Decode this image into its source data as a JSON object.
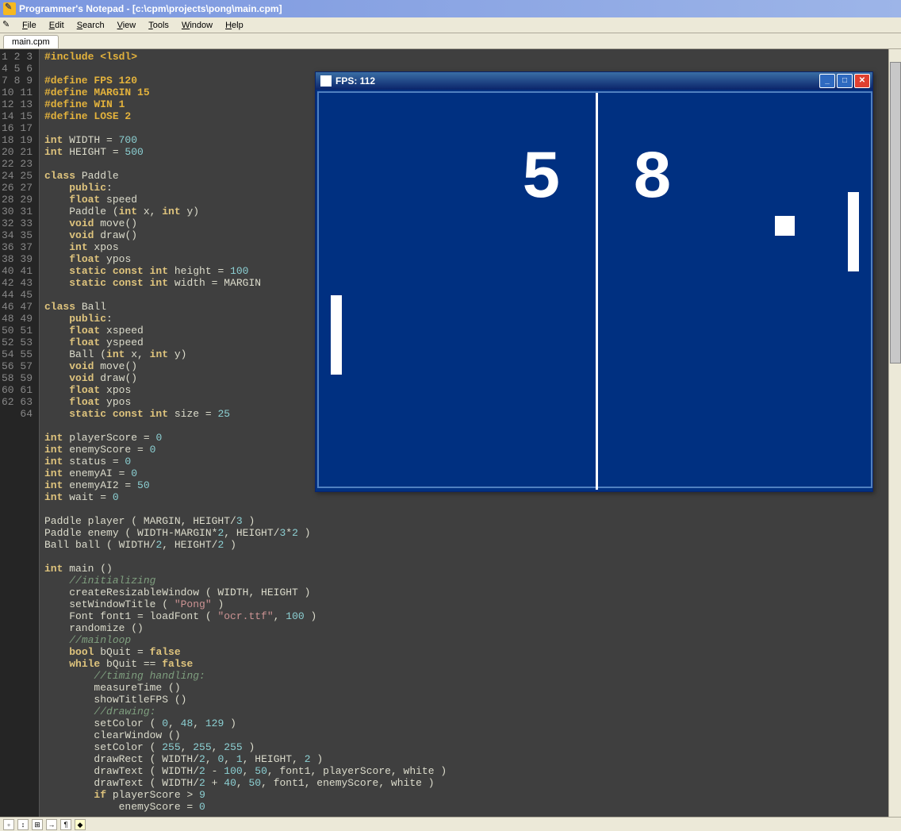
{
  "window_title": "Programmer's Notepad - [c:\\cpm\\projects\\pong\\main.cpm]",
  "menus": [
    "File",
    "Edit",
    "Search",
    "View",
    "Tools",
    "Window",
    "Help"
  ],
  "tab": "main.cpm",
  "line_count": 64,
  "code_lines": [
    {
      "n": 1,
      "html": "<span class='pp'>#include &lt;lsdl&gt;</span>"
    },
    {
      "n": 2,
      "html": ""
    },
    {
      "n": 3,
      "html": "<span class='pp'>#define FPS 120</span>"
    },
    {
      "n": 4,
      "html": "<span class='pp'>#define MARGIN 15</span>"
    },
    {
      "n": 5,
      "html": "<span class='pp'>#define WIN 1</span>"
    },
    {
      "n": 6,
      "html": "<span class='pp'>#define LOSE 2</span>"
    },
    {
      "n": 7,
      "html": ""
    },
    {
      "n": 8,
      "html": "<span class='kw'>int</span> WIDTH = <span class='num'>700</span>"
    },
    {
      "n": 9,
      "html": "<span class='kw'>int</span> HEIGHT = <span class='num'>500</span>"
    },
    {
      "n": 10,
      "html": ""
    },
    {
      "n": 11,
      "html": "<span class='kw'>class</span> Paddle"
    },
    {
      "n": 12,
      "html": "    <span class='kw'>public</span>:"
    },
    {
      "n": 13,
      "html": "    <span class='kw'>float</span> speed"
    },
    {
      "n": 14,
      "html": "    Paddle (<span class='kw'>int</span> x, <span class='kw'>int</span> y)"
    },
    {
      "n": 15,
      "html": "    <span class='kw'>void</span> move()"
    },
    {
      "n": 16,
      "html": "    <span class='kw'>void</span> draw()"
    },
    {
      "n": 17,
      "html": "    <span class='kw'>int</span> xpos"
    },
    {
      "n": 18,
      "html": "    <span class='kw'>float</span> ypos"
    },
    {
      "n": 19,
      "html": "    <span class='kw'>static const int</span> height = <span class='num'>100</span>"
    },
    {
      "n": 20,
      "html": "    <span class='kw'>static const int</span> width = MARGIN"
    },
    {
      "n": 21,
      "html": ""
    },
    {
      "n": 22,
      "html": "<span class='kw'>class</span> Ball"
    },
    {
      "n": 23,
      "html": "    <span class='kw'>public</span>:"
    },
    {
      "n": 24,
      "html": "    <span class='kw'>float</span> xspeed"
    },
    {
      "n": 25,
      "html": "    <span class='kw'>float</span> yspeed"
    },
    {
      "n": 26,
      "html": "    Ball (<span class='kw'>int</span> x, <span class='kw'>int</span> y)"
    },
    {
      "n": 27,
      "html": "    <span class='kw'>void</span> move()"
    },
    {
      "n": 28,
      "html": "    <span class='kw'>void</span> draw()"
    },
    {
      "n": 29,
      "html": "    <span class='kw'>float</span> xpos"
    },
    {
      "n": 30,
      "html": "    <span class='kw'>float</span> ypos"
    },
    {
      "n": 31,
      "html": "    <span class='kw'>static const int</span> size = <span class='num'>25</span>"
    },
    {
      "n": 32,
      "html": ""
    },
    {
      "n": 33,
      "html": "<span class='kw'>int</span> playerScore = <span class='num'>0</span>"
    },
    {
      "n": 34,
      "html": "<span class='kw'>int</span> enemyScore = <span class='num'>0</span>"
    },
    {
      "n": 35,
      "html": "<span class='kw'>int</span> status = <span class='num'>0</span>"
    },
    {
      "n": 36,
      "html": "<span class='kw'>int</span> enemyAI = <span class='num'>0</span>"
    },
    {
      "n": 37,
      "html": "<span class='kw'>int</span> enemyAI2 = <span class='num'>50</span>"
    },
    {
      "n": 38,
      "html": "<span class='kw'>int</span> wait = <span class='num'>0</span>"
    },
    {
      "n": 39,
      "html": ""
    },
    {
      "n": 40,
      "html": "Paddle player ( MARGIN, HEIGHT/<span class='num'>3</span> )"
    },
    {
      "n": 41,
      "html": "Paddle enemy ( WIDTH-MARGIN*<span class='num'>2</span>, HEIGHT/<span class='num'>3</span>*<span class='num'>2</span> )"
    },
    {
      "n": 42,
      "html": "Ball ball ( WIDTH/<span class='num'>2</span>, HEIGHT/<span class='num'>2</span> )"
    },
    {
      "n": 43,
      "html": ""
    },
    {
      "n": 44,
      "html": "<span class='kw'>int</span> main ()"
    },
    {
      "n": 45,
      "html": "    <span class='cmt'>//initializing</span>"
    },
    {
      "n": 46,
      "html": "    createResizableWindow ( WIDTH, HEIGHT )"
    },
    {
      "n": 47,
      "html": "    setWindowTitle ( <span class='str'>\"Pong\"</span> )"
    },
    {
      "n": 48,
      "html": "    Font font1 = loadFont ( <span class='str'>\"ocr.ttf\"</span>, <span class='num'>100</span> )"
    },
    {
      "n": 49,
      "html": "    randomize ()"
    },
    {
      "n": 50,
      "html": "    <span class='cmt'>//mainloop</span>"
    },
    {
      "n": 51,
      "html": "    <span class='kw'>bool</span> bQuit = <span class='kw'>false</span>"
    },
    {
      "n": 52,
      "html": "    <span class='kw'>while</span> bQuit == <span class='kw'>false</span>"
    },
    {
      "n": 53,
      "html": "        <span class='cmt'>//timing handling:</span>"
    },
    {
      "n": 54,
      "html": "        measureTime ()"
    },
    {
      "n": 55,
      "html": "        showTitleFPS ()"
    },
    {
      "n": 56,
      "html": "        <span class='cmt'>//drawing:</span>"
    },
    {
      "n": 57,
      "html": "        setColor ( <span class='num'>0</span>, <span class='num'>48</span>, <span class='num'>129</span> )"
    },
    {
      "n": 58,
      "html": "        clearWindow ()"
    },
    {
      "n": 59,
      "html": "        setColor ( <span class='num'>255</span>, <span class='num'>255</span>, <span class='num'>255</span> )"
    },
    {
      "n": 60,
      "html": "        drawRect ( WIDTH/<span class='num'>2</span>, <span class='num'>0</span>, <span class='num'>1</span>, HEIGHT, <span class='num'>2</span> )"
    },
    {
      "n": 61,
      "html": "        drawText ( WIDTH/<span class='num'>2</span> - <span class='num'>100</span>, <span class='num'>50</span>, font1, playerScore, white )"
    },
    {
      "n": 62,
      "html": "        drawText ( WIDTH/<span class='num'>2</span> + <span class='num'>40</span>, <span class='num'>50</span>, font1, enemyScore, white )"
    },
    {
      "n": 63,
      "html": "        <span class='kw'>if</span> playerScore &gt; <span class='num'>9</span>"
    },
    {
      "n": 64,
      "html": "            enemyScore = <span class='num'>0</span>"
    }
  ],
  "game": {
    "title": "FPS: 112",
    "score_left": "5",
    "score_right": "8"
  },
  "statusbar_icons": [
    "⬒",
    "↕",
    "⊞",
    "→",
    "¶",
    "🔖"
  ]
}
